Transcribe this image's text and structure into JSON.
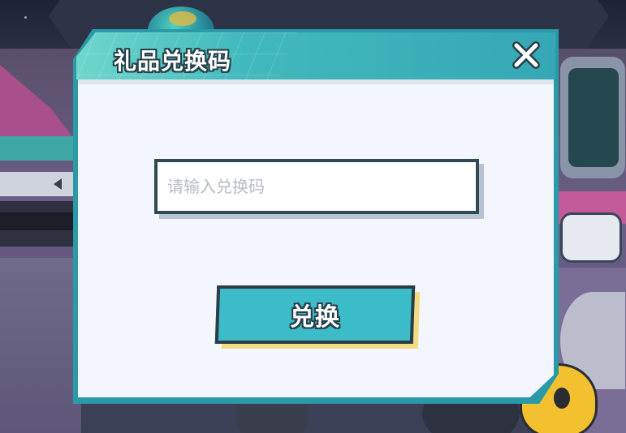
{
  "dialog": {
    "title": "礼品兑换码",
    "close_icon": "close-icon",
    "input": {
      "value": "",
      "placeholder": "请输入兑换码"
    },
    "redeem_label": "兑换"
  },
  "colors": {
    "accent": "#3bbcc8",
    "border": "#2b9aa8",
    "outline": "#2b3e48",
    "panel": "#f3f6fc",
    "button_shadow": "#f1dc84"
  }
}
